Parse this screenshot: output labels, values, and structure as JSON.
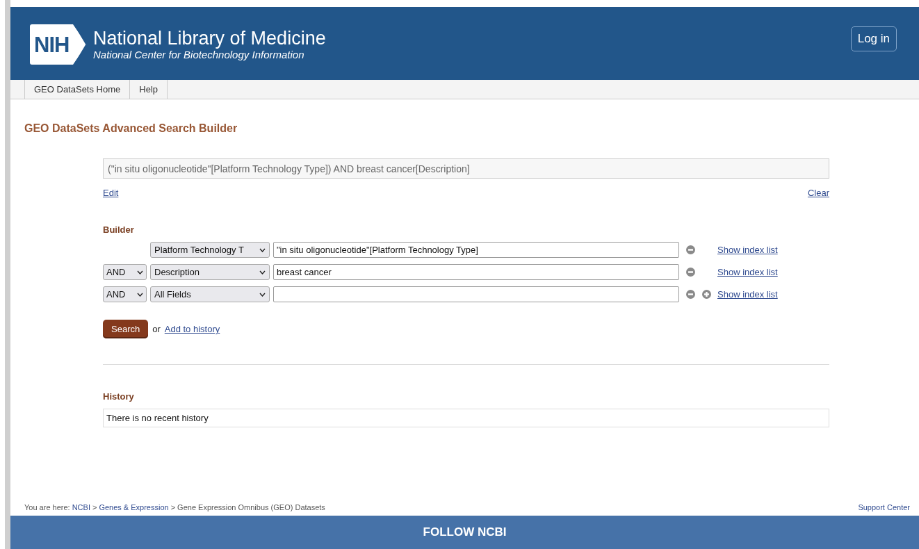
{
  "header": {
    "logo": "NIH",
    "title": "National Library of Medicine",
    "subtitle": "National Center for Biotechnology Information",
    "login": "Log in"
  },
  "nav": [
    "GEO DataSets Home",
    "Help"
  ],
  "page_title": "GEO DataSets Advanced Search Builder",
  "query": {
    "value": "(\"in situ oligonucleotide\"[Platform Technology Type]) AND breast cancer[Description]",
    "edit": "Edit",
    "clear": "Clear"
  },
  "builder": {
    "label": "Builder",
    "rows": [
      {
        "field": "Platform Technology T",
        "value": "\"in situ oligonucleotide\"[Platform Technology Type]",
        "add_button": false,
        "index_link": "Show index list"
      },
      {
        "operator": "AND",
        "field": "Description",
        "value": "breast cancer",
        "add_button": false,
        "index_link": "Show index list"
      },
      {
        "operator": "AND",
        "field": "All Fields",
        "add_button": true,
        "index_link": "Show index list"
      }
    ],
    "search": "Search",
    "or": "or",
    "add_to_history": "Add to history"
  },
  "history": {
    "label": "History",
    "message": "There is no recent history"
  },
  "breadcrumb": {
    "prefix": "You are here:",
    "items": [
      {
        "text": "NCBI",
        "link": true
      },
      {
        "text": "Genes & Expression",
        "link": true
      },
      {
        "text": "Gene Expression Omnibus (GEO) Datasets",
        "link": false
      }
    ],
    "separator": ">"
  },
  "support": "Support Center",
  "footer": {
    "title": "FOLLOW NCBI"
  }
}
